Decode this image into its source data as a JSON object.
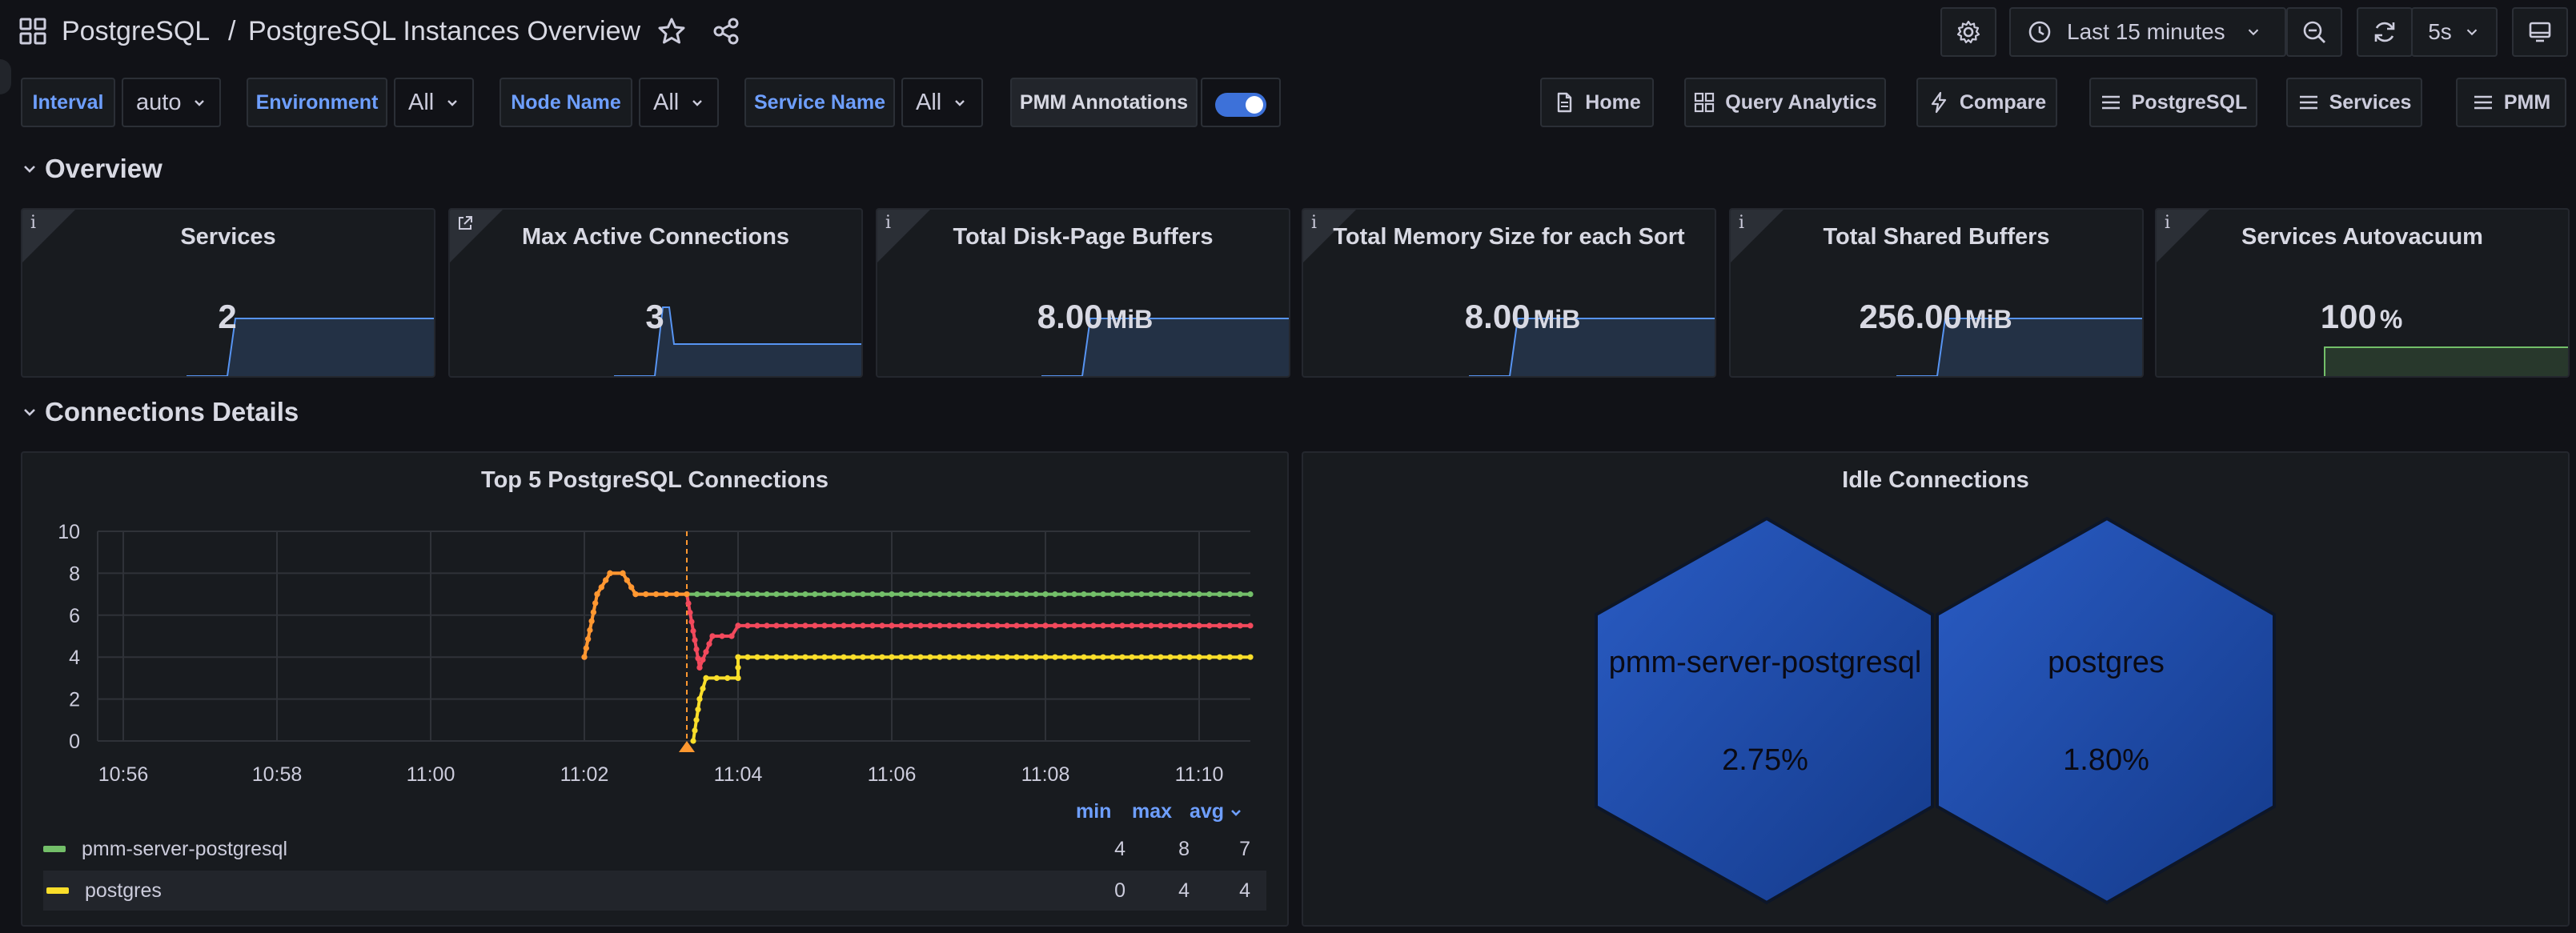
{
  "breadcrumb": {
    "folder": "PostgreSQL",
    "separator": "/",
    "dashboard": "PostgreSQL Instances Overview"
  },
  "toolbar": {
    "time_range": "Last 15 minutes",
    "refresh_interval": "5s"
  },
  "variables": [
    {
      "label": "Interval",
      "value": "auto"
    },
    {
      "label": "Environment",
      "value": "All"
    },
    {
      "label": "Node Name",
      "value": "All"
    },
    {
      "label": "Service Name",
      "value": "All"
    }
  ],
  "annotations": {
    "label": "PMM Annotations",
    "enabled": true
  },
  "links": [
    {
      "label": "Home",
      "icon": "document-icon"
    },
    {
      "label": "Query Analytics",
      "icon": "apps-icon"
    },
    {
      "label": "Compare",
      "icon": "bolt-icon"
    },
    {
      "label": "PostgreSQL",
      "icon": "bars-icon"
    },
    {
      "label": "Services",
      "icon": "bars-icon"
    },
    {
      "label": "PMM",
      "icon": "bars-icon"
    }
  ],
  "rows": {
    "overview": "Overview",
    "connections": "Connections Details"
  },
  "stats": [
    {
      "title": "Services",
      "value": "2",
      "unit": "",
      "corner": "i",
      "spark_color": "#5794f2"
    },
    {
      "title": "Max Active Connections",
      "value": "3",
      "unit": "",
      "corner": "link",
      "spark_color": "#5794f2"
    },
    {
      "title": "Total Disk-Page Buffers",
      "value": "8.00",
      "unit": "MiB",
      "corner": "i",
      "spark_color": "#5794f2"
    },
    {
      "title": "Total Memory Size for each Sort",
      "value": "8.00",
      "unit": "MiB",
      "corner": "i",
      "spark_color": "#5794f2"
    },
    {
      "title": "Total Shared Buffers",
      "value": "256.00",
      "unit": "MiB",
      "corner": "i",
      "spark_color": "#5794f2"
    },
    {
      "title": "Services Autovacuum",
      "value": "100",
      "unit": "%",
      "corner": "i",
      "spark_color": "#73bf69"
    }
  ],
  "connections_panel": {
    "title": "Top 5 PostgreSQL Connections",
    "legend_headers": {
      "min": "min",
      "max": "max",
      "avg": "avg"
    },
    "legend": [
      {
        "name": "pmm-server-postgresql",
        "min": "4",
        "max": "8",
        "avg": "7"
      },
      {
        "name": "postgres",
        "min": "0",
        "max": "4",
        "avg": "4"
      }
    ]
  },
  "chart_data": {
    "type": "line",
    "x_tick_labels": [
      "10:56",
      "10:58",
      "11:00",
      "11:02",
      "11:04",
      "11:06",
      "11:08",
      "11:10"
    ],
    "xlim": [
      "10:55:40",
      "11:10:40"
    ],
    "ylim": [
      0,
      10
    ],
    "y_ticks": [
      0,
      2,
      4,
      6,
      8,
      10
    ],
    "grid": true,
    "annotation_time": "11:03:20",
    "series": [
      {
        "name": "pmm-server-postgresql",
        "color": "#73bf69",
        "points": [
          [
            "11:03:20",
            7
          ],
          [
            "11:04",
            7
          ],
          [
            "11:06",
            7
          ],
          [
            "11:08",
            7
          ],
          [
            "11:10",
            7
          ],
          [
            "11:10:40",
            7
          ]
        ]
      },
      {
        "name": "postgres",
        "color": "#fade2a",
        "points": [
          [
            "11:03:25",
            0
          ],
          [
            "11:03:30",
            2
          ],
          [
            "11:03:35",
            3
          ],
          [
            "11:04",
            3
          ],
          [
            "11:04:00",
            4
          ],
          [
            "11:06",
            4
          ],
          [
            "11:08",
            4
          ],
          [
            "11:10",
            4
          ],
          [
            "11:10:40",
            4
          ]
        ]
      },
      {
        "color": "#f2495c",
        "points": [
          [
            "11:02:00",
            4
          ],
          [
            "11:02:10",
            7
          ],
          [
            "11:02:20",
            8
          ],
          [
            "11:02:30",
            8
          ],
          [
            "11:02:40",
            7
          ],
          [
            "11:03:20",
            7
          ],
          [
            "11:03:30",
            3.5
          ],
          [
            "11:03:40",
            5
          ],
          [
            "11:03:55",
            5
          ],
          [
            "11:04:00",
            5.5
          ],
          [
            "11:06",
            5.5
          ],
          [
            "11:08",
            5.5
          ],
          [
            "11:10",
            5.5
          ],
          [
            "11:10:40",
            5.5
          ]
        ]
      },
      {
        "color": "#ff9830",
        "points": [
          [
            "11:02:00",
            4
          ],
          [
            "11:02:10",
            7
          ],
          [
            "11:02:20",
            8
          ],
          [
            "11:02:30",
            8
          ],
          [
            "11:02:40",
            7
          ],
          [
            "11:03:20",
            7
          ]
        ]
      }
    ]
  },
  "idle_panel": {
    "title": "Idle Connections",
    "cells": [
      {
        "name": "pmm-server-postgresql",
        "value": "2.75%"
      },
      {
        "name": "postgres",
        "value": "1.80%"
      }
    ]
  }
}
